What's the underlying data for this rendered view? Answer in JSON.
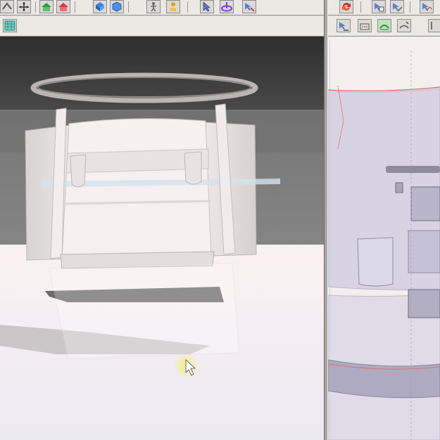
{
  "app": {
    "accent": "#3a7bd5",
    "highlight_cursor": "#f2ec7a"
  },
  "toolbar_left": {
    "buttons": [
      {
        "name": "rotate-view-icon"
      },
      {
        "name": "move-view-icon"
      },
      {
        "name": "home-view-icon"
      },
      {
        "name": "home-reset-icon"
      },
      {
        "name": "select-garment-icon"
      },
      {
        "name": "cube-view-icon"
      },
      {
        "name": "avatar-pose-icon"
      },
      {
        "name": "avatar-pin-icon"
      },
      {
        "name": "select-arrow-icon"
      },
      {
        "name": "transform-gizmo-icon"
      },
      {
        "name": "arrange-point-icon"
      }
    ]
  },
  "toolbar_right": {
    "buttons": [
      {
        "name": "sync-icon"
      },
      {
        "name": "edit-pattern-icon"
      },
      {
        "name": "edit-point-icon"
      },
      {
        "name": "edit-curve-icon"
      }
    ]
  },
  "subtoolbar_left": {
    "buttons": [
      {
        "name": "texture-grid-icon"
      }
    ]
  },
  "subtoolbar_right": {
    "buttons": [
      {
        "name": "sew-segment-icon"
      },
      {
        "name": "sew-free-icon"
      },
      {
        "name": "sew-active-icon"
      },
      {
        "name": "sew-multi-icon"
      },
      {
        "name": "more-tools-icon"
      }
    ]
  }
}
